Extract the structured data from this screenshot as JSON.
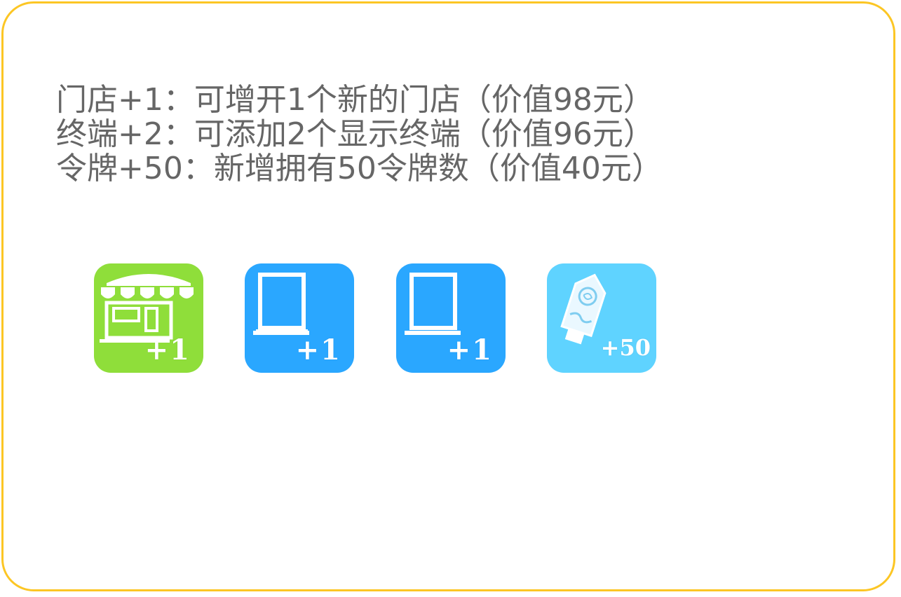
{
  "description": {
    "lines": [
      "门店+1：可增开1个新的门店（价值98元）",
      "终端+2：可添加2个显示终端（价值96元）",
      "令牌+50：新增拥有50令牌数（价值40元）"
    ]
  },
  "tiles": [
    {
      "icon": "storefront-icon",
      "badge": "+1",
      "color": "#8fde3a"
    },
    {
      "icon": "display-terminal-icon",
      "badge": "+1",
      "color": "#2aa7ff"
    },
    {
      "icon": "display-terminal-icon",
      "badge": "+1",
      "color": "#2aa7ff"
    },
    {
      "icon": "token-tag-icon",
      "badge": "+50",
      "color": "#5fd3ff"
    }
  ],
  "colors": {
    "border": "#fcc624",
    "text": "#666666"
  }
}
